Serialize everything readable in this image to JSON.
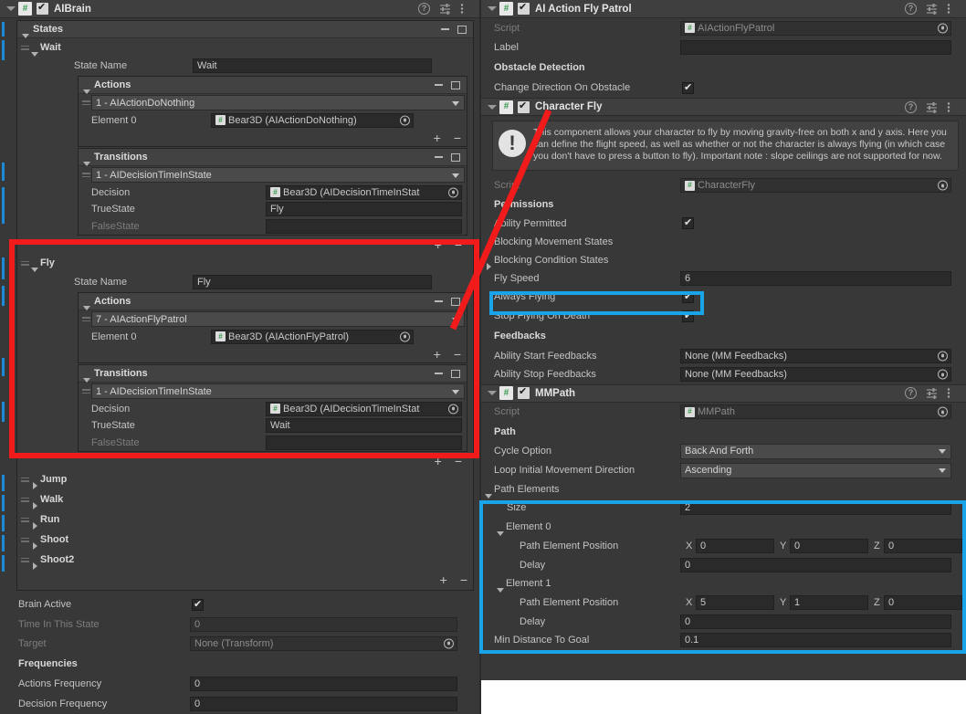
{
  "left_panel": {
    "component": {
      "title": "AIBrain",
      "icon": "cs-script-icon",
      "enabled": true,
      "help_icon": "help-icon",
      "preset_icon": "preset-icon",
      "menu_icon": "kebab-menu-icon"
    },
    "states_box": {
      "label": "States"
    },
    "states": [
      {
        "name": "Wait",
        "expanded": true,
        "state_name_label": "State Name",
        "state_name_value": "Wait",
        "actions": {
          "label": "Actions",
          "entry": "1 - AIActionDoNothing",
          "element_label": "Element 0",
          "element_value": "Bear3D (AIActionDoNothing)"
        },
        "transitions": {
          "label": "Transitions",
          "entry": "1 - AIDecisionTimeInState",
          "decision_label": "Decision",
          "decision_value": "Bear3D (AIDecisionTimeInStat",
          "truestate_label": "TrueState",
          "truestate_value": "Fly",
          "falsestate_label": "FalseState",
          "falsestate_value": ""
        }
      },
      {
        "name": "Fly",
        "expanded": true,
        "state_name_label": "State Name",
        "state_name_value": "Fly",
        "actions": {
          "label": "Actions",
          "entry": "7 - AIActionFlyPatrol",
          "element_label": "Element 0",
          "element_value": "Bear3D (AIActionFlyPatrol)"
        },
        "transitions": {
          "label": "Transitions",
          "entry": "1 - AIDecisionTimeInState",
          "decision_label": "Decision",
          "decision_value": "Bear3D (AIDecisionTimeInStat",
          "truestate_label": "TrueState",
          "truestate_value": "Wait",
          "falsestate_label": "FalseState",
          "falsestate_value": ""
        }
      }
    ],
    "collapsed_states": [
      "Jump",
      "Walk",
      "Run",
      "Shoot",
      "Shoot2"
    ],
    "brain_active": {
      "label": "Brain Active",
      "checked": true
    },
    "time_in_state": {
      "label": "Time In This State",
      "value": "0"
    },
    "target": {
      "label": "Target",
      "value": "None (Transform)"
    },
    "frequencies_header": "Frequencies",
    "actions_frequency": {
      "label": "Actions Frequency",
      "value": "0"
    },
    "decision_frequency": {
      "label": "Decision Frequency",
      "value": "0"
    }
  },
  "right_panel": {
    "fly_patrol": {
      "title": "AI Action Fly Patrol",
      "enabled": true,
      "script_label": "Script",
      "script_value": "AIActionFlyPatrol",
      "label_label": "Label",
      "label_value": "",
      "obstacle_header": "Obstacle Detection",
      "change_direction": {
        "label": "Change Direction On Obstacle",
        "checked": true
      }
    },
    "character_fly": {
      "title": "Character Fly",
      "enabled": true,
      "info": "This component allows your character to fly by moving gravity-free on both x and y axis. Here you can define the flight speed, as well as whether or not the character is always flying (in which case you don't have to press a button to fly). Important note : slope ceilings are not supported for now.",
      "script_label": "Script",
      "script_value": "CharacterFly",
      "permissions_header": "Permissions",
      "ability_permitted": {
        "label": "Ability Permitted",
        "checked": true
      },
      "blocking_movement_states": "Blocking Movement States",
      "blocking_condition_states": "Blocking Condition States",
      "fly_speed": {
        "label": "Fly Speed",
        "value": "6"
      },
      "always_flying": {
        "label": "Always Flying",
        "checked": true
      },
      "stop_flying_on_death": {
        "label": "Stop Flying On Death",
        "checked": true
      },
      "feedbacks_header": "Feedbacks",
      "ability_start_feedbacks": {
        "label": "Ability Start Feedbacks",
        "value": "None (MM Feedbacks)"
      },
      "ability_stop_feedbacks": {
        "label": "Ability Stop Feedbacks",
        "value": "None (MM Feedbacks)"
      }
    },
    "mmpath": {
      "title": "MMPath",
      "enabled": true,
      "script_label": "Script",
      "script_value": "MMPath",
      "path_header": "Path",
      "cycle_option": {
        "label": "Cycle Option",
        "value": "Back And Forth"
      },
      "loop_initial": {
        "label": "Loop Initial Movement Direction",
        "value": "Ascending"
      },
      "path_elements_label": "Path Elements",
      "size": {
        "label": "Size",
        "value": "2"
      },
      "elements": [
        {
          "label": "Element 0",
          "position_label": "Path Element Position",
          "x": "0",
          "y": "0",
          "z": "0",
          "delay_label": "Delay",
          "delay": "0"
        },
        {
          "label": "Element 1",
          "position_label": "Path Element Position",
          "x": "5",
          "y": "1",
          "z": "0",
          "delay_label": "Delay",
          "delay": "0"
        }
      ],
      "min_distance": {
        "label": "Min Distance To Goal",
        "value": "0.1"
      }
    }
  },
  "annotations": {
    "red_color": "#f21b1b",
    "cyan_color": "#19a3e8",
    "axis_x": "X",
    "axis_y": "Y",
    "axis_z": "Z"
  }
}
